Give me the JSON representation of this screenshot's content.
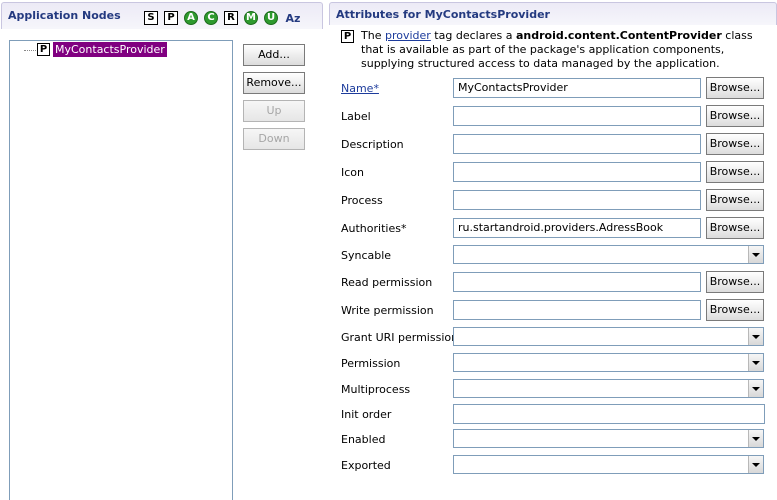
{
  "left": {
    "title": "Application Nodes",
    "toolbar": [
      {
        "label": "S",
        "style": "sq"
      },
      {
        "label": "P",
        "style": "sq"
      },
      {
        "label": "A",
        "style": "circ"
      },
      {
        "label": "C",
        "style": "circ"
      },
      {
        "label": "R",
        "style": "sq"
      },
      {
        "label": "M",
        "style": "circ"
      },
      {
        "label": "U",
        "style": "circ"
      },
      {
        "label": "Az",
        "style": "az"
      }
    ],
    "tree_node": {
      "icon": "P",
      "label": "MyContactsProvider"
    },
    "buttons": {
      "add": "Add...",
      "remove": "Remove...",
      "up": "Up",
      "down": "Down"
    }
  },
  "right": {
    "title": "Attributes for MyContactsProvider",
    "desc": {
      "icon": "P",
      "pre": "The ",
      "link": "provider",
      "mid": " tag declares a ",
      "cls": "android.content.ContentProvider",
      "post": " class that is available as part of the package's application components, supplying structured access to data managed by the application."
    },
    "browse_label": "Browse...",
    "fields": {
      "name": {
        "label": "Name*",
        "value": "MyContactsProvider"
      },
      "label": {
        "label": "Label",
        "value": ""
      },
      "description": {
        "label": "Description",
        "value": ""
      },
      "icon": {
        "label": "Icon",
        "value": ""
      },
      "process": {
        "label": "Process",
        "value": ""
      },
      "authorities": {
        "label": "Authorities*",
        "value": "ru.startandroid.providers.AdressBook"
      },
      "syncable": {
        "label": "Syncable",
        "value": ""
      },
      "read_permission": {
        "label": "Read permission",
        "value": ""
      },
      "write_permission": {
        "label": "Write permission",
        "value": ""
      },
      "grant_uri": {
        "label": "Grant URI permissions",
        "value": ""
      },
      "permission": {
        "label": "Permission",
        "value": ""
      },
      "multiprocess": {
        "label": "Multiprocess",
        "value": ""
      },
      "init_order": {
        "label": "Init order",
        "value": ""
      },
      "enabled": {
        "label": "Enabled",
        "value": ""
      },
      "exported": {
        "label": "Exported",
        "value": ""
      }
    }
  }
}
